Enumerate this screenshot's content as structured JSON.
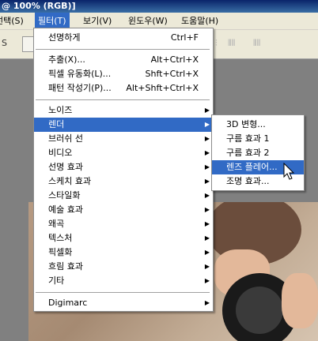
{
  "title": "@ 100% (RGB)]",
  "menubar": [
    {
      "label": "선택(S)"
    },
    {
      "label": "필터(T)",
      "active": true
    },
    {
      "label": "보기(V)"
    },
    {
      "label": "윈도우(W)"
    },
    {
      "label": "도움말(H)"
    }
  ],
  "toolbar": {
    "left_glyph": "S"
  },
  "filter_menu": {
    "top": [
      {
        "label": "선명하게",
        "shortcut": "Ctrl+F"
      }
    ],
    "group2": [
      {
        "label": "추출(X)...",
        "shortcut": "Alt+Ctrl+X"
      },
      {
        "label": "픽셀 유동화(L)...",
        "shortcut": "Shft+Ctrl+X"
      },
      {
        "label": "패턴 작성기(P)...",
        "shortcut": "Alt+Shft+Ctrl+X"
      }
    ],
    "group3": [
      {
        "label": "노이즈"
      },
      {
        "label": "렌더",
        "highlighted": true
      },
      {
        "label": "브러쉬 선"
      },
      {
        "label": "비디오"
      },
      {
        "label": "선명 효과"
      },
      {
        "label": "스케치 효과"
      },
      {
        "label": "스타일화"
      },
      {
        "label": "예술 효과"
      },
      {
        "label": "왜곡"
      },
      {
        "label": "텍스처"
      },
      {
        "label": "픽셀화"
      },
      {
        "label": "흐림 효과"
      },
      {
        "label": "기타"
      }
    ],
    "group4": [
      {
        "label": "Digimarc"
      }
    ]
  },
  "render_menu": [
    {
      "label": "3D 변형..."
    },
    {
      "label": "구름 효과 1"
    },
    {
      "label": "구름 효과 2"
    },
    {
      "label": "렌즈 플레어...",
      "highlighted": true
    },
    {
      "label": "조명 효과..."
    }
  ],
  "colors": {
    "highlight": "#316ac5",
    "menubar": "#ece9d8",
    "workspace": "#808080"
  },
  "icons": {
    "submenu": "arrow-right-icon",
    "cursor": "pointer-cursor-icon"
  }
}
